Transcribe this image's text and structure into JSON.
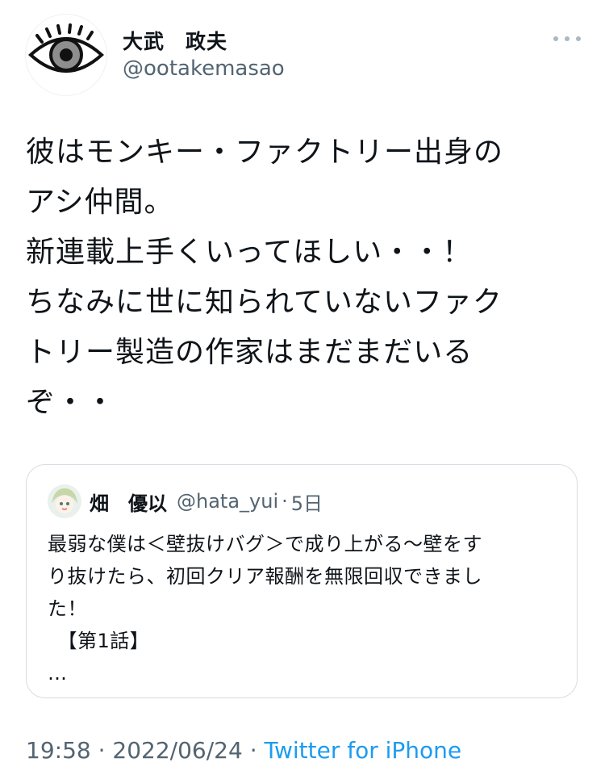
{
  "author": {
    "name": "大武　政夫",
    "handle": "@ootakemasao",
    "avatar_icon": "eye-icon"
  },
  "menu_icon": "more-options-icon",
  "tweet": {
    "text": "彼はモンキー・ファクトリー出身の\nアシ仲間。\n新連載上手くいってほしい・・！\nちなみに世に知られていないファク\nトリー製造の作家はまだまだいる\nぞ・・"
  },
  "quoted": {
    "name": "畑　優以",
    "handle": "@hata_yui",
    "separator": "·",
    "time": "5日",
    "text": "最弱な僕は＜壁抜けバグ＞で成り上がる〜壁をす\nり抜けたら、初回クリア報酬を無限回収できまし\nた！\n　【第1話】\n…"
  },
  "footer": {
    "time": "19:58",
    "sep1": " · ",
    "date": "2022/06/24",
    "sep2": " · ",
    "source": "Twitter for iPhone"
  },
  "colors": {
    "text": "#0f1419",
    "secondary": "#536471",
    "link": "#1d9bf0",
    "border": "#d7dde2"
  }
}
